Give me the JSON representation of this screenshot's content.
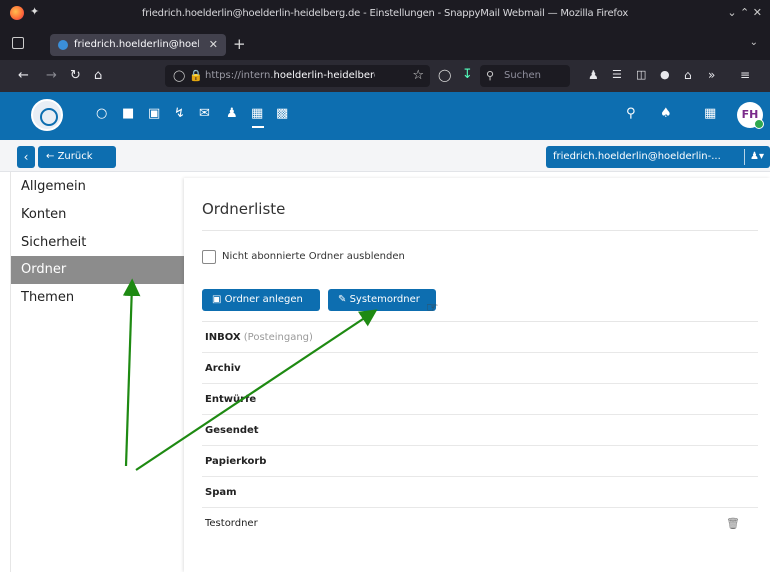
{
  "browser": {
    "window_title": "friedrich.hoelderlin@hoelderlin-heidelberg.de - Einstellungen - SnappyMail Webmail — Mozilla Firefox",
    "tab_title": "friedrich.hoelderlin@hoel",
    "url_prefix": "https://intern.",
    "url_domain": "hoelderlin-heidelberg",
    "search_placeholder": "Suchen"
  },
  "app": {
    "avatar_initials": "FH",
    "accent_color": "#0d6eb0"
  },
  "toolbar": {
    "back_label": "Zurück",
    "account_label": "friedrich.hoelderlin@hoelderlin-..."
  },
  "sidebar": {
    "items": [
      {
        "label": "Allgemein"
      },
      {
        "label": "Konten"
      },
      {
        "label": "Sicherheit"
      },
      {
        "label": "Ordner",
        "active": true
      },
      {
        "label": "Themen"
      }
    ]
  },
  "main": {
    "title": "Ordnerliste",
    "hide_unsubscribed_label": "Nicht abonnierte Ordner ausblenden",
    "create_folder_label": "Ordner anlegen",
    "system_folders_label": "Systemordner",
    "folders": [
      {
        "name": "INBOX",
        "sub": "(Posteingang)"
      },
      {
        "name": "Archiv"
      },
      {
        "name": "Entwürfe"
      },
      {
        "name": "Gesendet"
      },
      {
        "name": "Papierkorb"
      },
      {
        "name": "Spam"
      },
      {
        "name": "Testordner"
      }
    ]
  },
  "annotation": {
    "arrow_color": "#1e8a12"
  }
}
